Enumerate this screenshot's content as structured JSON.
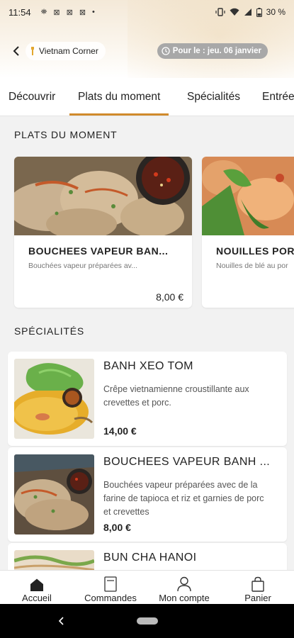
{
  "status_bar": {
    "time": "11:54",
    "notifications": [
      "⛯",
      "⊠",
      "⊠",
      "⊠",
      "•"
    ],
    "battery": "30 %"
  },
  "header": {
    "back_icon": "arrow-left-icon",
    "store_name": "Vietnam Corner",
    "date_label": "Pour le : jeu. 06 janvier"
  },
  "tabs": [
    {
      "label": "Découvrir",
      "active": false
    },
    {
      "label": "Plats du moment",
      "active": true
    },
    {
      "label": "Spécialités",
      "active": false
    },
    {
      "label": "Entrées",
      "active": false
    }
  ],
  "accent_color": "#d08a2c",
  "sections": {
    "moment_title": "PLATS DU MOMENT",
    "specialites_title": "SPÉCIALITÉS"
  },
  "moment_items": [
    {
      "title": "BOUCHEES VAPEUR BAN...",
      "desc": "Bouchées vapeur préparées av...",
      "price": "8,00 €"
    },
    {
      "title": "NOUILLES POR",
      "desc": "Nouilles de blé au por",
      "price": ""
    }
  ],
  "specialites_items": [
    {
      "title": "BANH XEO TOM",
      "desc": "Crêpe vietnamienne croustillante aux crevettes et porc.",
      "price": "14,00 €"
    },
    {
      "title": "BOUCHEES VAPEUR BANH ...",
      "desc": "Bouchées vapeur préparées avec de la farine de tapioca et riz et garnies de porc et crevettes",
      "price": "8,00 €"
    },
    {
      "title": "BUN CHA HANOI",
      "desc": "",
      "price": ""
    }
  ],
  "bottom_nav": [
    {
      "label": "Accueil",
      "icon": "home-icon"
    },
    {
      "label": "Commandes",
      "icon": "receipt-icon"
    },
    {
      "label": "Mon compte",
      "icon": "user-icon"
    },
    {
      "label": "Panier",
      "icon": "bag-icon"
    }
  ]
}
